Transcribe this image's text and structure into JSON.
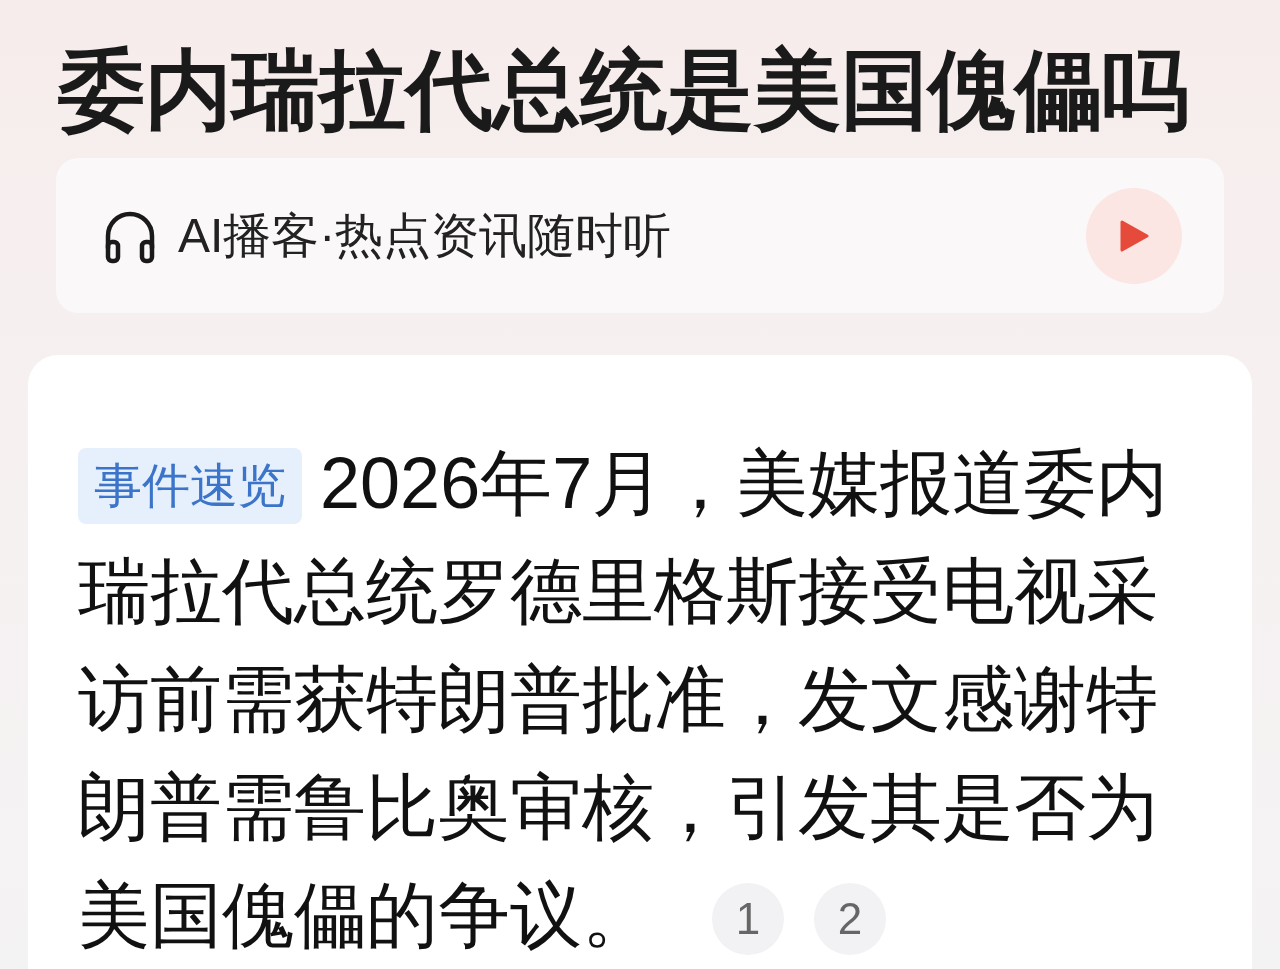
{
  "title": "委内瑞拉代总统是美国傀儡吗",
  "podcast_bar": {
    "label": "AI播客·热点资讯随时听"
  },
  "summary": {
    "tag": "事件速览",
    "text": "2026年7月，美媒报道委内瑞拉代总统罗德里格斯接受电视采访前需获特朗普批准，发文感谢特朗普需鲁比奥审核，引发其是否为美国傀儡的争议。",
    "citations": [
      "1",
      "2"
    ]
  }
}
